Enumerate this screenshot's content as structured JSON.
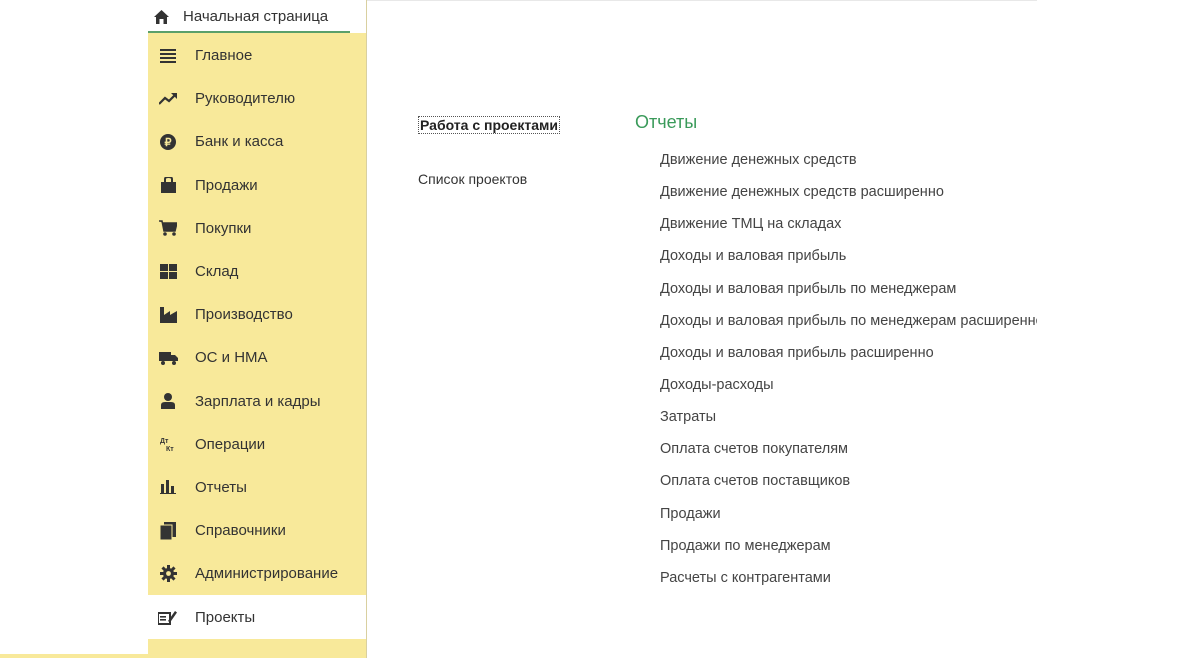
{
  "home_tab": {
    "label": "Начальная страница",
    "icon": "home-icon"
  },
  "sidebar": {
    "items": [
      {
        "label": "Главное",
        "icon": "menu-lines-icon"
      },
      {
        "label": "Руководителю",
        "icon": "trend-up-icon"
      },
      {
        "label": "Банк и касса",
        "icon": "ruble-coin-icon"
      },
      {
        "label": "Продажи",
        "icon": "shopping-bag-icon"
      },
      {
        "label": "Покупки",
        "icon": "cart-icon"
      },
      {
        "label": "Склад",
        "icon": "warehouse-icon"
      },
      {
        "label": "Производство",
        "icon": "factory-icon"
      },
      {
        "label": "ОС и НМА",
        "icon": "truck-icon"
      },
      {
        "label": "Зарплата и кадры",
        "icon": "person-icon"
      },
      {
        "label": "Операции",
        "icon": "dt-kt-icon"
      },
      {
        "label": "Отчеты",
        "icon": "bar-chart-icon"
      },
      {
        "label": "Справочники",
        "icon": "books-icon"
      },
      {
        "label": "Администрирование",
        "icon": "gear-icon"
      },
      {
        "label": "Проекты",
        "icon": "project-pen-icon",
        "active": true
      }
    ]
  },
  "main": {
    "section_title": "Работа с проектами",
    "project_list_link": "Список проектов",
    "reports_heading": "Отчеты",
    "reports": [
      "Движение денежных средств",
      "Движение денежных средств расширенно",
      "Движение ТМЦ на складах",
      "Доходы и валовая прибыль",
      "Доходы и валовая прибыль по менеджерам",
      "Доходы и валовая прибыль по менеджерам расширенно",
      "Доходы и валовая прибыль расширенно",
      "Доходы-расходы",
      "Затраты",
      "Оплата счетов покупателям",
      "Оплата счетов поставщиков",
      "Продажи",
      "Продажи по менеджерам",
      "Расчеты с контрагентами"
    ]
  },
  "colors": {
    "sidebar_bg": "#f8e99a",
    "accent_green": "#3a9a5a",
    "active_item_bg": "#ffffff"
  }
}
